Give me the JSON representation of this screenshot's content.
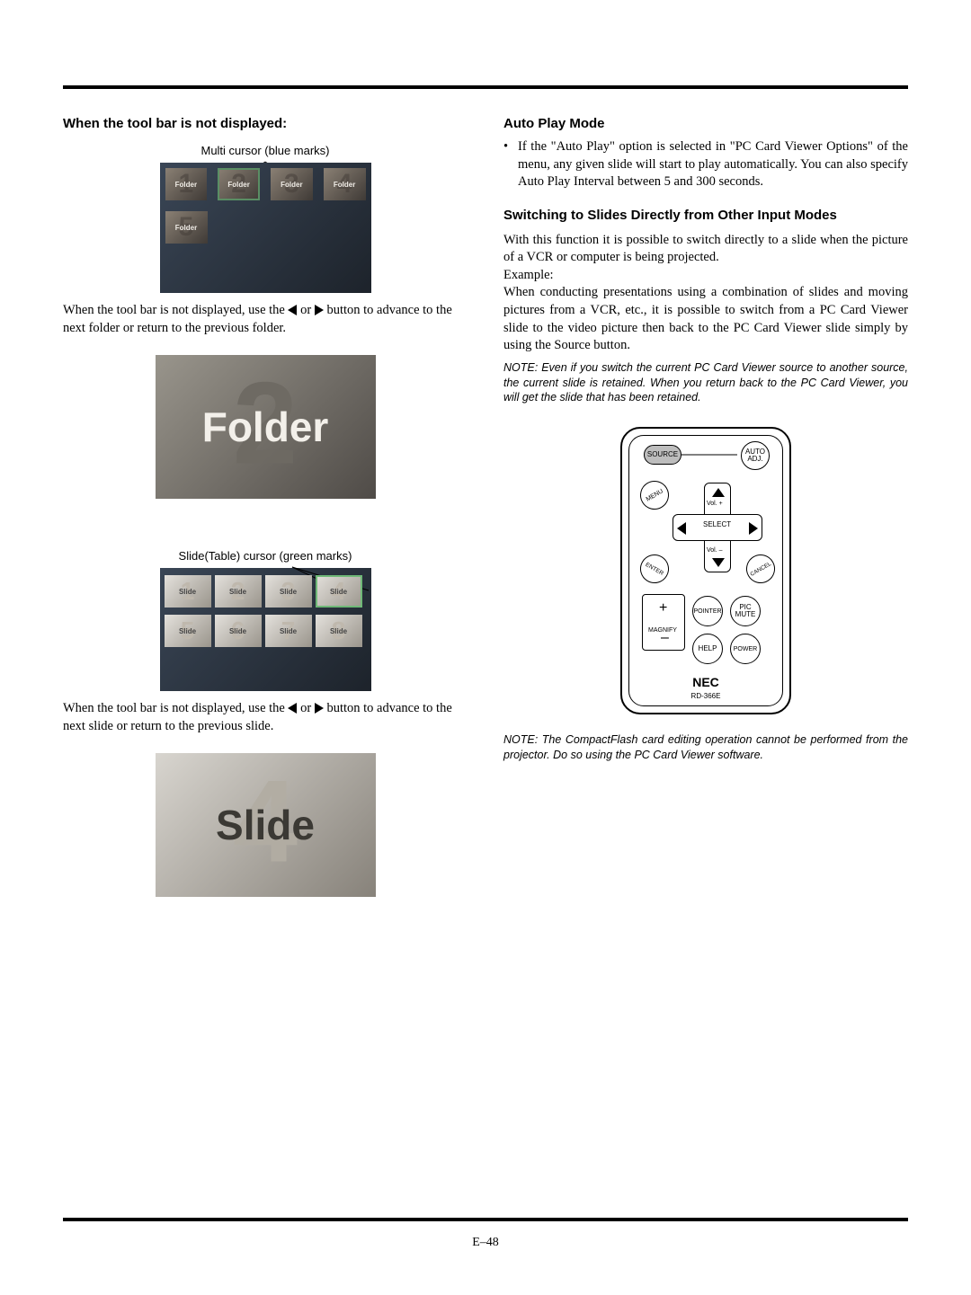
{
  "page_number": "E–48",
  "left": {
    "heading1": "When the tool bar is not displayed:",
    "caption_folders": "Multi cursor (blue marks)",
    "folders": [
      {
        "num": "1",
        "lab": "Folder"
      },
      {
        "num": "2",
        "lab": "Folder"
      },
      {
        "num": "3",
        "lab": "Folder"
      },
      {
        "num": "4",
        "lab": "Folder"
      },
      {
        "num": "5",
        "lab": "Folder"
      }
    ],
    "para1_a": "When the tool bar is not displayed, use the ",
    "para1_or": " or ",
    "para1_b": " button to advance to the next  folder or return to the previous folder.",
    "big_folder_num": "2",
    "big_folder_label": "Folder",
    "caption_slides": "Slide(Table) cursor (green marks)",
    "slides": [
      {
        "num": "1",
        "lab": "Slide"
      },
      {
        "num": "2",
        "lab": "Slide"
      },
      {
        "num": "3",
        "lab": "Slide"
      },
      {
        "num": "4",
        "lab": "Slide"
      },
      {
        "num": "5",
        "lab": "Slide"
      },
      {
        "num": "6",
        "lab": "Slide"
      },
      {
        "num": "7",
        "lab": "Slide"
      },
      {
        "num": "8",
        "lab": "Slide"
      }
    ],
    "para2_a": "When the tool bar is not displayed, use the ",
    "para2_or": " or ",
    "para2_b": " button to advance to the next slide or return to the previous slide.",
    "big_slide_num": "4",
    "big_slide_label": "Slide"
  },
  "right": {
    "heading_autoplay": "Auto Play Mode",
    "autoplay_bullet": "If the \"Auto Play\" option is selected in \"PC Card Viewer Options\" of the menu, any given slide will start to play automatically. You can also specify Auto Play Interval between 5 and 300 seconds.",
    "heading_switch": "Switching to Slides Directly from Other Input Modes",
    "switch_para1": "With this function it is possible to switch directly to a slide when the picture of a VCR or computer is being projected.",
    "switch_example": "Example:",
    "switch_para2": "When conducting presentations using a combination of slides and moving pictures from a VCR, etc., it is possible to switch from a PC Card Viewer slide to the video picture then back to the PC Card Viewer slide simply by using the Source button.",
    "note1": "NOTE: Even if you switch the current PC Card Viewer source to another source, the current slide is retained. When you return back to the PC Card Viewer, you will get the slide that has been retained.",
    "remote": {
      "source": "SOURCE",
      "autoadj": "AUTO\nADJ.",
      "menu": "MENU",
      "select": "SELECT",
      "volplus": "Vol. +",
      "volminus": "Vol. –",
      "enter": "ENTER",
      "cancel": "CANCEL",
      "pointer": "POINTER",
      "picmute": "PIC\nMUTE",
      "magnify": "MAGNIFY",
      "help": "HELP",
      "power": "POWER",
      "brand": "NEC",
      "model": "RD-366E"
    },
    "note2": "NOTE: The CompactFlash card editing operation cannot be performed from the projector.  Do so using the PC Card Viewer software."
  }
}
